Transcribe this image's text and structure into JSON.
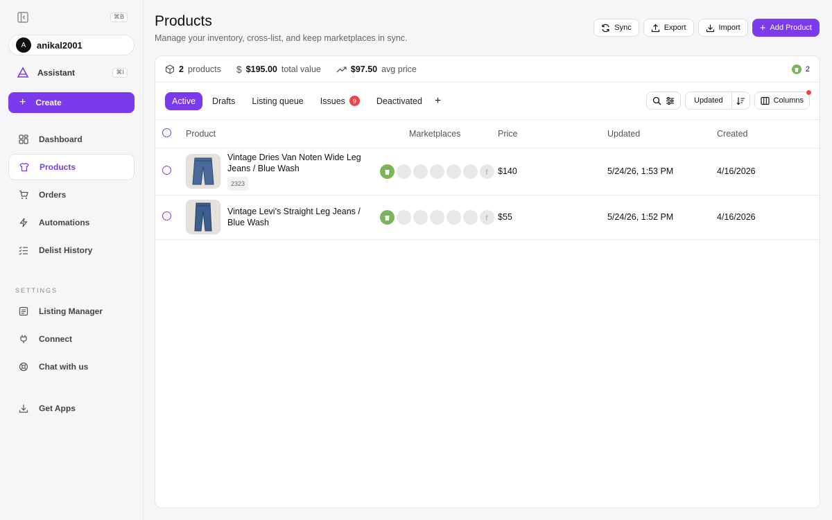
{
  "sidebar": {
    "collapse_shortcut": "⌘B",
    "user": {
      "initial": "A",
      "name": "anikal2001"
    },
    "assistant": {
      "label": "Assistant",
      "shortcut": "⌘I"
    },
    "create_label": "Create",
    "nav": [
      {
        "label": "Dashboard",
        "icon": "dashboard-icon"
      },
      {
        "label": "Products",
        "icon": "shirt-icon",
        "active": true
      },
      {
        "label": "Orders",
        "icon": "cart-icon"
      },
      {
        "label": "Automations",
        "icon": "bolt-icon"
      },
      {
        "label": "Delist History",
        "icon": "checklist-icon"
      }
    ],
    "settings_label": "SETTINGS",
    "settings_nav": [
      {
        "label": "Listing Manager",
        "icon": "list-icon"
      },
      {
        "label": "Connect",
        "icon": "plug-icon"
      },
      {
        "label": "Chat with us",
        "icon": "chat-icon"
      }
    ],
    "get_apps_label": "Get Apps"
  },
  "header": {
    "title": "Products",
    "subtitle": "Manage your inventory, cross-list, and keep marketplaces in sync.",
    "buttons": {
      "sync": "Sync",
      "export": "Export",
      "import": "Import",
      "add": "Add Product"
    }
  },
  "stats": {
    "products_count": "2",
    "products_label": "products",
    "total_value": "$195.00",
    "total_value_label": "total value",
    "avg_price": "$97.50",
    "avg_price_label": "avg price",
    "shopify_count": "2"
  },
  "tabs": {
    "active": "Active",
    "drafts": "Drafts",
    "queue": "Listing queue",
    "issues": "Issues",
    "issues_count": "9",
    "deactivated": "Deactivated"
  },
  "toolbar": {
    "sort_label": "Updated",
    "columns_label": "Columns"
  },
  "table": {
    "headers": {
      "product": "Product",
      "marketplaces": "Marketplaces",
      "price": "Price",
      "updated": "Updated",
      "created": "Created"
    },
    "rows": [
      {
        "title": "Vintage Dries Van Noten Wide Leg Jeans / Blue Wash",
        "sku": "2323",
        "price": "$140",
        "updated": "5/24/26, 1:53 PM",
        "created": "4/16/2026"
      },
      {
        "title": "Vintage Levi's Straight Leg Jeans / Blue Wash",
        "sku": "",
        "price": "$55",
        "updated": "5/24/26, 1:52 PM",
        "created": "4/16/2026"
      }
    ]
  },
  "colors": {
    "accent": "#7c3aed",
    "shopify": "#7ab55c",
    "badge": "#ef4444"
  }
}
